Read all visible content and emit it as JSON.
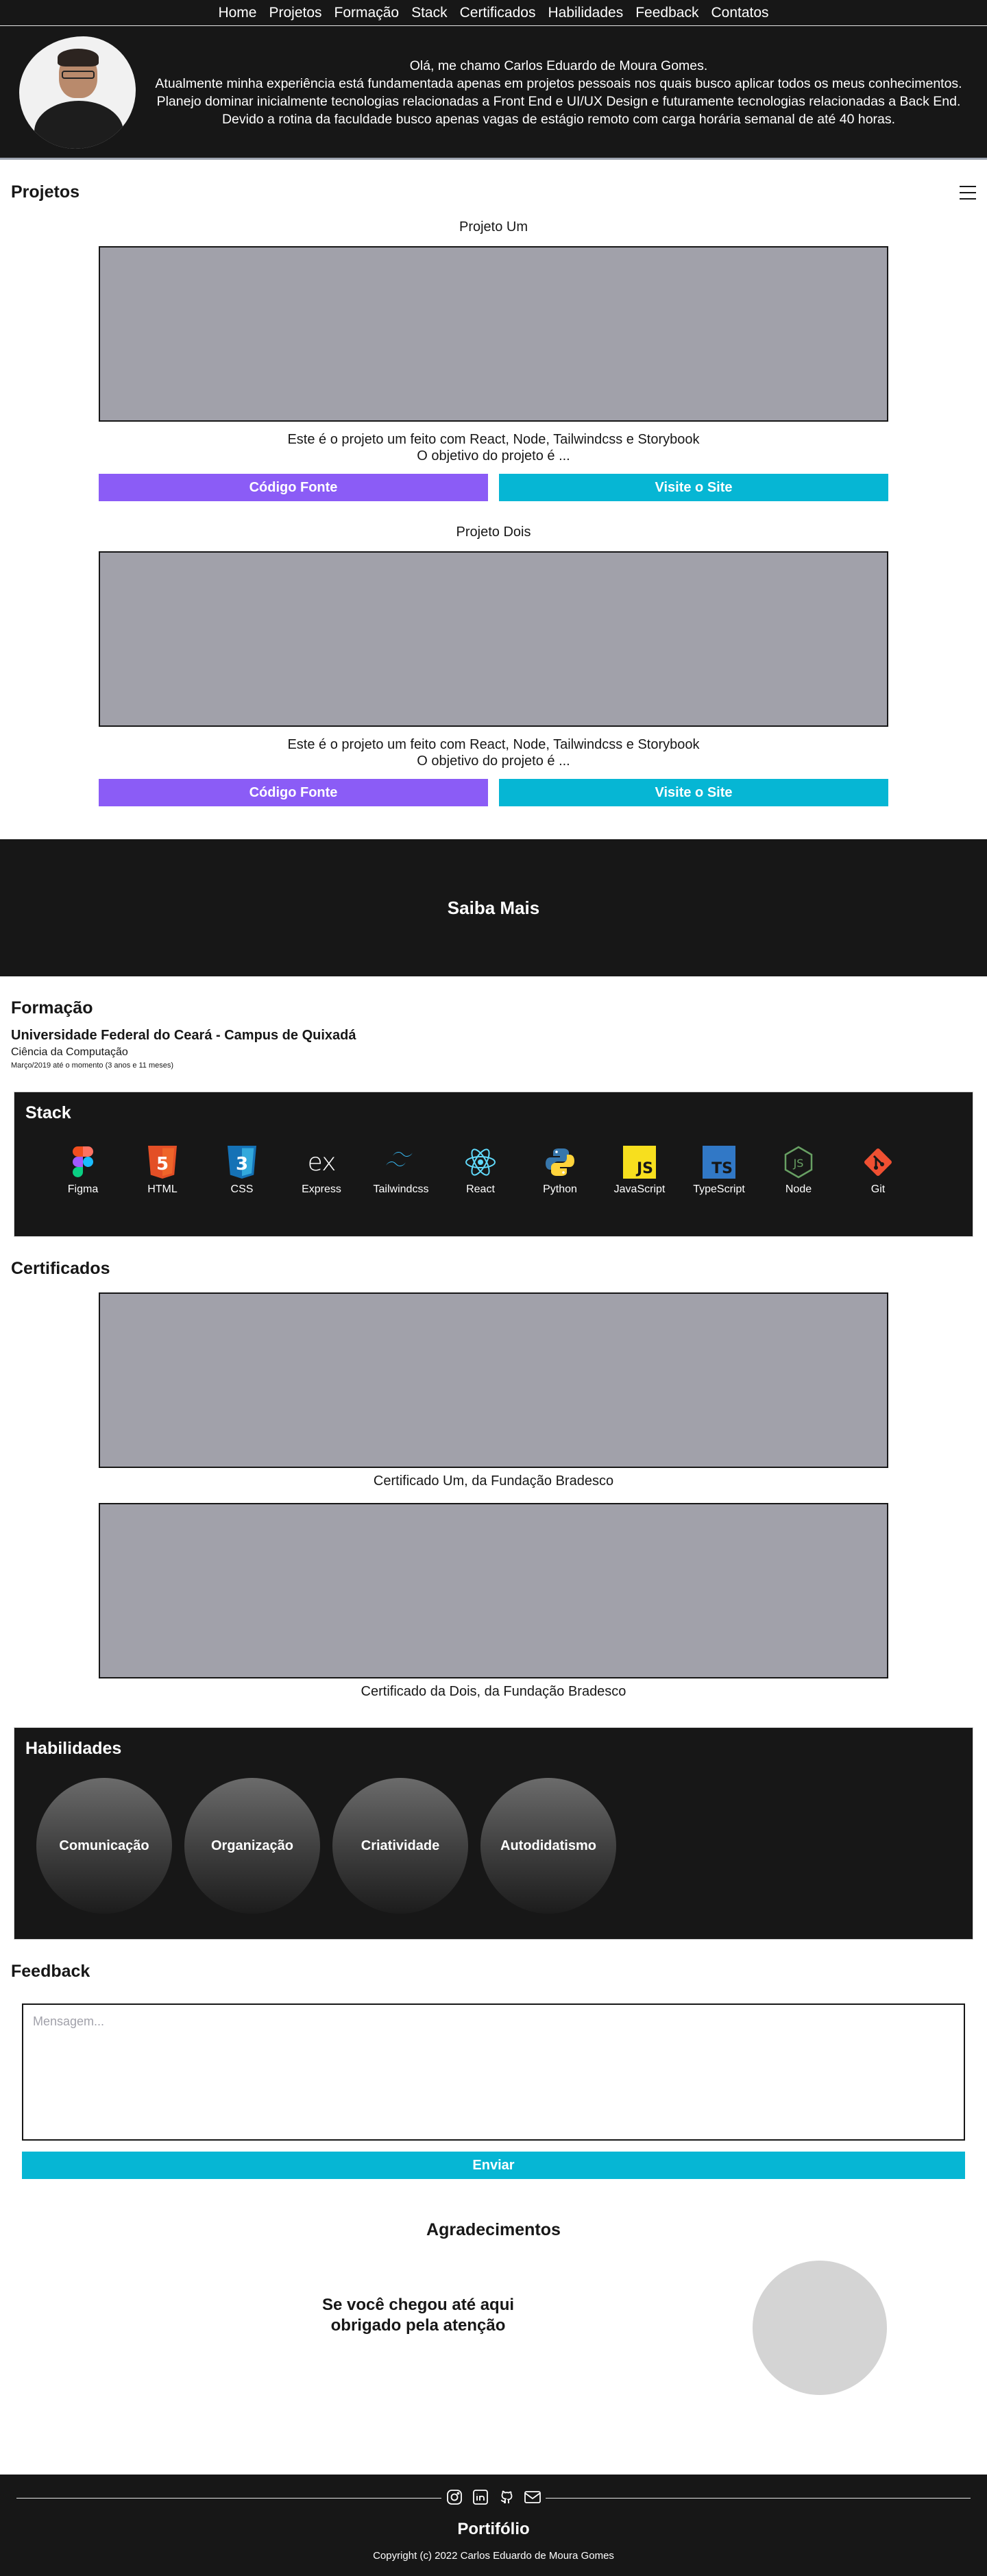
{
  "nav": {
    "items": [
      "Home",
      "Projetos",
      "Formação",
      "Stack",
      "Certificados",
      "Habilidades",
      "Feedback",
      "Contatos"
    ]
  },
  "hero": {
    "line1": "Olá, me chamo Carlos Eduardo de Moura Gomes.",
    "line2": "Atualmente minha experiência está fundamentada apenas em projetos pessoais nos quais busco aplicar todos os meus conhecimentos.",
    "line3": "Planejo dominar inicialmente tecnologias relacionadas a Front End e UI/UX Design e futuramente tecnologias relacionadas a Back End. Devido a rotina da faculdade busco apenas vagas de estágio remoto com carga horária semanal de até 40 horas."
  },
  "projects": {
    "title": "Projetos",
    "items": [
      {
        "name": "Projeto Um",
        "desc1": "Este é o projeto um feito com React, Node, Tailwindcss e Storybook",
        "desc2": "O objetivo do projeto é ...",
        "source_label": "Código Fonte",
        "site_label": "Visite o Site"
      },
      {
        "name": "Projeto Dois",
        "desc1": "Este é o projeto um feito com React, Node, Tailwindcss e Storybook",
        "desc2": "O objetivo do projeto é ...",
        "source_label": "Código Fonte",
        "site_label": "Visite o Site"
      }
    ]
  },
  "saiba_mais": "Saiba Mais",
  "formacao": {
    "title": "Formação",
    "university": "Universidade Federal do Ceará - Campus de Quixadá",
    "course": "Ciência da Computação",
    "period": "Março/2019 até o momento (3 anos e 11 meses)"
  },
  "stack": {
    "title": "Stack",
    "items": [
      {
        "label": "Figma",
        "icon": "figma-icon"
      },
      {
        "label": "HTML",
        "icon": "html5-icon"
      },
      {
        "label": "CSS",
        "icon": "css3-icon"
      },
      {
        "label": "Express",
        "icon": "express-icon",
        "glyph": "ex"
      },
      {
        "label": "Tailwindcss",
        "icon": "tailwindcss-icon"
      },
      {
        "label": "React",
        "icon": "react-icon"
      },
      {
        "label": "Python",
        "icon": "python-icon"
      },
      {
        "label": "JavaScript",
        "icon": "javascript-icon",
        "glyph": "JS"
      },
      {
        "label": "TypeScript",
        "icon": "typescript-icon",
        "glyph": "TS"
      },
      {
        "label": "Node",
        "icon": "nodejs-icon",
        "glyph": "JS"
      },
      {
        "label": "Git",
        "icon": "git-icon"
      }
    ],
    "html_glyph": "5",
    "css_glyph": "3"
  },
  "certificados": {
    "title": "Certificados",
    "items": [
      {
        "caption": "Certificado Um, da Fundação Bradesco"
      },
      {
        "caption": "Certificado da Dois, da Fundação Bradesco"
      }
    ]
  },
  "habilidades": {
    "title": "Habilidades",
    "items": [
      "Comunicação",
      "Organização",
      "Criatividade",
      "Autodidatismo"
    ]
  },
  "feedback": {
    "title": "Feedback",
    "placeholder": "Mensagem...",
    "send_label": "Enviar"
  },
  "agradecimentos": {
    "title": "Agradecimentos",
    "line1": "Se você chegou até aqui",
    "line2": "obrigado pela atenção"
  },
  "footer": {
    "title": "Portifólio",
    "copyright": "Copyright (c) 2022 Carlos Eduardo de Moura Gomes",
    "icons": [
      "instagram-icon",
      "linkedin-icon",
      "github-icon",
      "mail-icon"
    ]
  },
  "colors": {
    "dark": "#171717",
    "purple": "#8b5cf6",
    "cyan": "#06b6d4",
    "placeholder_gray": "#a1a1aa"
  }
}
